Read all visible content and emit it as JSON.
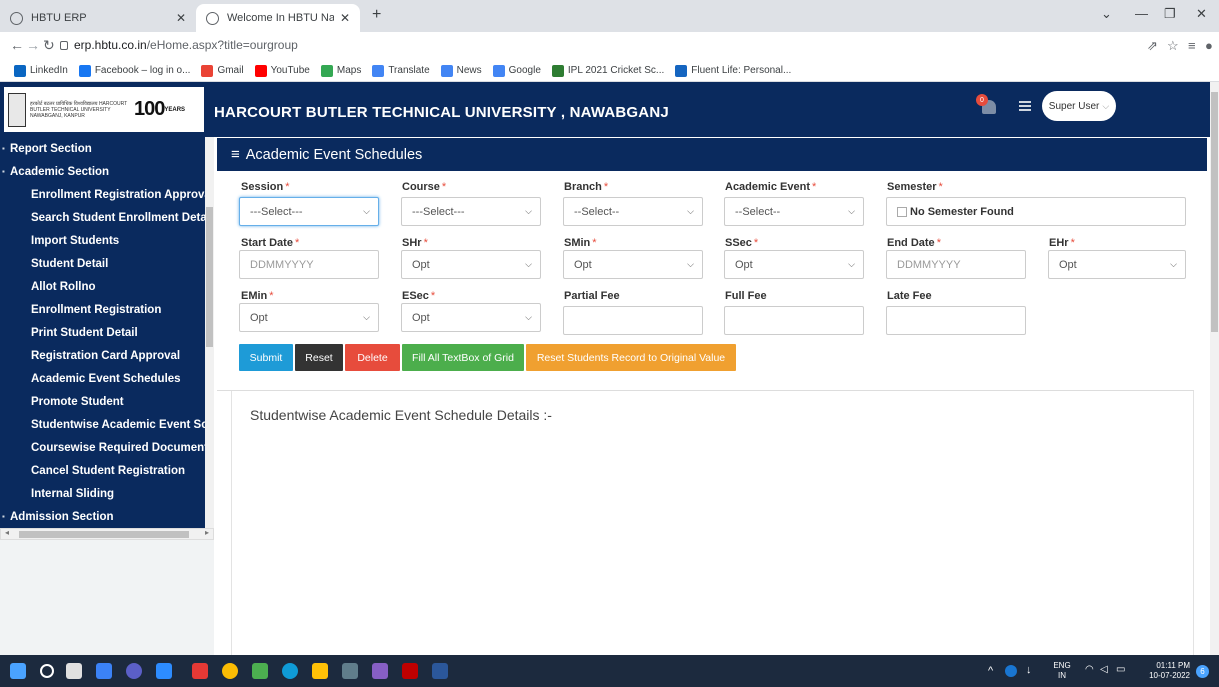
{
  "browser": {
    "tabs": [
      {
        "title": "HBTU ERP",
        "active": false
      },
      {
        "title": "Welcome In HBTU Nawabganj Co",
        "active": true
      }
    ],
    "url_host": "erp.hbtu.co.in",
    "url_path": "/eHome.aspx?title=ourgroup",
    "bookmarks": [
      {
        "label": "LinkedIn",
        "icon": "linkedin-icon",
        "color": "#0a66c2"
      },
      {
        "label": "Facebook – log in o...",
        "icon": "facebook-icon",
        "color": "#1877f2"
      },
      {
        "label": "Gmail",
        "icon": "gmail-icon",
        "color": "#ea4335"
      },
      {
        "label": "YouTube",
        "icon": "youtube-icon",
        "color": "#ff0000"
      },
      {
        "label": "Maps",
        "icon": "maps-icon",
        "color": "#34a853"
      },
      {
        "label": "Translate",
        "icon": "translate-icon",
        "color": "#4285f4"
      },
      {
        "label": "News",
        "icon": "news-icon",
        "color": "#4285f4"
      },
      {
        "label": "Google",
        "icon": "google-icon",
        "color": "#4285f4"
      },
      {
        "label": "IPL 2021 Cricket Sc...",
        "icon": "cricket-icon",
        "color": "#2e7d32"
      },
      {
        "label": "Fluent Life: Personal...",
        "icon": "flag-icon",
        "color": "#1565c0"
      }
    ]
  },
  "header": {
    "title": "HARCOURT BUTLER TECHNICAL UNIVERSITY , NAWABGANJ",
    "logo_text": "हरकोर्ट बटलर प्राविधिक विश्वविद्यालय HARCOURT BUTLER TECHNICAL UNIVERSITY NAWABGANJ, KANPUR",
    "logo_years": "100",
    "logo_years_suffix": "YEARS",
    "notification_count": "0",
    "user": "Super User"
  },
  "sidebar": {
    "items": [
      {
        "label": "Report Section",
        "type": "section"
      },
      {
        "label": "Academic Section",
        "type": "section"
      },
      {
        "label": "Enrollment Registration Approva",
        "type": "sub"
      },
      {
        "label": "Search Student Enrollment Deta",
        "type": "sub"
      },
      {
        "label": "Import Students",
        "type": "sub"
      },
      {
        "label": "Student Detail",
        "type": "sub"
      },
      {
        "label": "Allot Rollno",
        "type": "sub"
      },
      {
        "label": "Enrollment Registration",
        "type": "sub"
      },
      {
        "label": "Print Student Detail",
        "type": "sub"
      },
      {
        "label": "Registration Card Approval",
        "type": "sub"
      },
      {
        "label": "Academic Event Schedules",
        "type": "sub"
      },
      {
        "label": "Promote Student",
        "type": "sub"
      },
      {
        "label": "Studentwise Academic Event Sc",
        "type": "sub"
      },
      {
        "label": "Coursewise Required Document",
        "type": "sub"
      },
      {
        "label": "Cancel Student Registration",
        "type": "sub"
      },
      {
        "label": "Internal Sliding",
        "type": "sub"
      },
      {
        "label": "Admission Section",
        "type": "section"
      }
    ]
  },
  "panel": {
    "title": "Academic Event Schedules"
  },
  "form": {
    "session": {
      "label": "Session",
      "value": "---Select---"
    },
    "course": {
      "label": "Course",
      "value": "---Select---"
    },
    "branch": {
      "label": "Branch",
      "value": "--Select--"
    },
    "academic_event": {
      "label": "Academic Event",
      "value": "--Select--"
    },
    "semester": {
      "label": "Semester",
      "value": "No Semester Found"
    },
    "start_date": {
      "label": "Start Date",
      "placeholder": "DDMMYYYY"
    },
    "shr": {
      "label": "SHr",
      "value": "Opt"
    },
    "smin": {
      "label": "SMin",
      "value": "Opt"
    },
    "ssec": {
      "label": "SSec",
      "value": "Opt"
    },
    "end_date": {
      "label": "End Date",
      "placeholder": "DDMMYYYY"
    },
    "ehr": {
      "label": "EHr",
      "value": "Opt"
    },
    "emin": {
      "label": "EMin",
      "value": "Opt"
    },
    "esec": {
      "label": "ESec",
      "value": "Opt"
    },
    "partial_fee": {
      "label": "Partial Fee",
      "value": ""
    },
    "full_fee": {
      "label": "Full Fee",
      "value": ""
    },
    "late_fee": {
      "label": "Late Fee",
      "value": ""
    },
    "required_mark": "*"
  },
  "buttons": {
    "submit": {
      "label": "Submit",
      "color": "#1e9bd7"
    },
    "reset": {
      "label": "Reset",
      "color": "#333333"
    },
    "delete": {
      "label": "Delete",
      "color": "#e74c3c"
    },
    "fill_all": {
      "label": "Fill All TextBox of Grid",
      "color": "#4cae4c"
    },
    "reset_students": {
      "label": "Reset Students Record to Original Value",
      "color": "#f0a030"
    }
  },
  "details": {
    "title": "Studentwise Academic Event Schedule Details :-"
  },
  "taskbar": {
    "lang_top": "ENG",
    "lang_bottom": "IN",
    "time": "01:11 PM",
    "date": "10-07-2022",
    "notif_count": "6"
  }
}
